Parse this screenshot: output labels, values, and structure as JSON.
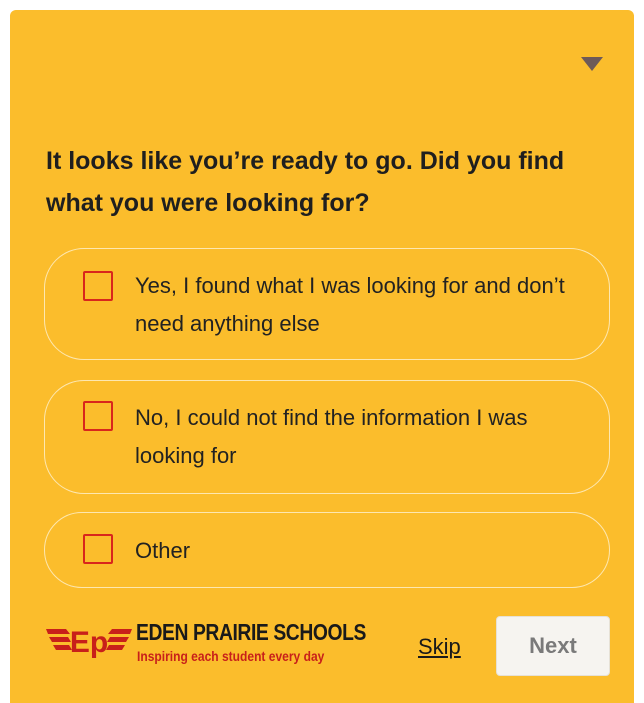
{
  "survey": {
    "collapse_icon": "triangle-down-icon",
    "question": "It looks like you’re ready to go. Did you find what you were looking for?",
    "options": [
      {
        "label": "Yes, I found what I was looking for and don’t need anything else",
        "checked": false
      },
      {
        "label": "No, I could not find the information I was looking for",
        "checked": false
      },
      {
        "label": "Other",
        "checked": false
      }
    ]
  },
  "footer": {
    "logo_mark": "Ep",
    "logo_name": "EDEN PRAIRIE SCHOOLS",
    "logo_tagline": "Inspiring each student every day",
    "skip_label": "Skip",
    "next_label": "Next"
  },
  "colors": {
    "panel_background": "#fbbd2c",
    "checkbox_border": "#d9261c",
    "brand_red": "#c8201a",
    "option_border": "#fde7b0",
    "next_button_background": "#f6f4f0"
  }
}
